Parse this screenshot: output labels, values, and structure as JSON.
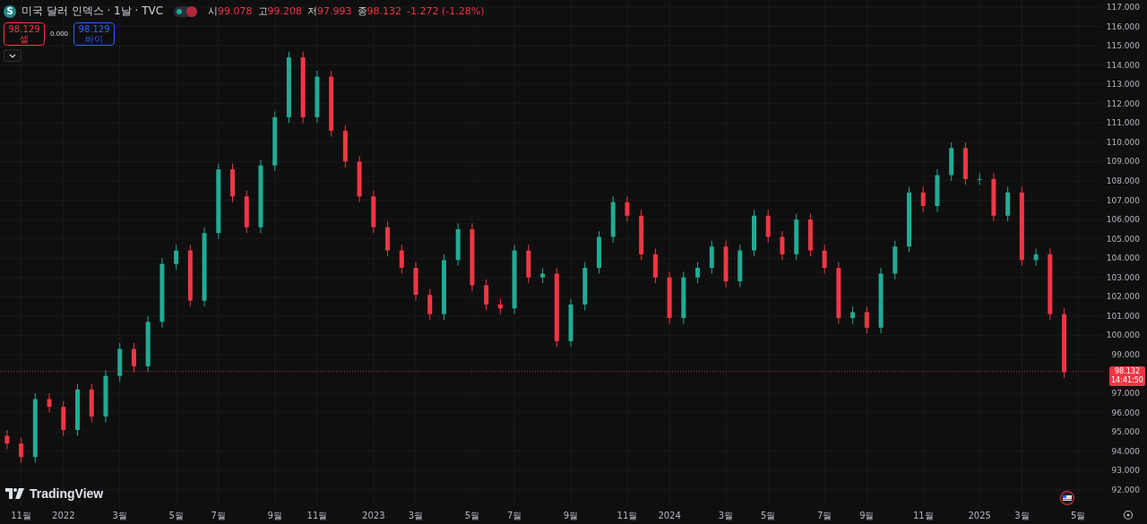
{
  "legend": {
    "symbol_letter": "S",
    "title": "미국 달러 인덱스 · 1날 · TVC",
    "ohlc": [
      {
        "label": "시",
        "value": "99.078"
      },
      {
        "label": "고",
        "value": "99.208"
      },
      {
        "label": "저",
        "value": "97.993"
      },
      {
        "label": "종",
        "value": "98.132"
      }
    ],
    "change": "-1.272 (-1.28%)"
  },
  "trade": {
    "sell_price": "98.129",
    "sell_label": "셀",
    "spread": "0.000",
    "buy_price": "98.129",
    "buy_label": "바이"
  },
  "last_price": {
    "price": "98.132",
    "countdown": "14:41:50"
  },
  "brand": "TradingView",
  "chart_data": {
    "type": "candlestick",
    "ylim": [
      91.16,
      117.37
    ],
    "grid": true,
    "ref_lines": [
      {
        "axis": "y",
        "value": 98.132,
        "color": "#f23645"
      }
    ],
    "categories": [
      null,
      "11월",
      null,
      null,
      "2022",
      null,
      null,
      null,
      "3월",
      null,
      null,
      null,
      "5월",
      null,
      null,
      "7월",
      null,
      null,
      null,
      "9월",
      null,
      null,
      "11월",
      null,
      null,
      null,
      "2023",
      null,
      null,
      "3월",
      null,
      null,
      null,
      "5월",
      null,
      null,
      "7월",
      null,
      null,
      null,
      "9월",
      null,
      null,
      null,
      "11월",
      null,
      null,
      "2024",
      null,
      null,
      null,
      "3월",
      null,
      null,
      "5월",
      null,
      null,
      null,
      "7월",
      null,
      null,
      "9월",
      null,
      null,
      null,
      "11월",
      null,
      null,
      null,
      "2025",
      null,
      null,
      "3월",
      null,
      null,
      null,
      "5월"
    ],
    "yticks": [
      {
        "value": 92,
        "label": "92.000"
      },
      {
        "value": 93,
        "label": "93.000"
      },
      {
        "value": 94,
        "label": "94.000"
      },
      {
        "value": 95,
        "label": "95.000"
      },
      {
        "value": 96,
        "label": "96.000"
      },
      {
        "value": 97,
        "label": "97.000"
      },
      {
        "value": 99,
        "label": "99.000"
      },
      {
        "value": 100,
        "label": "100.000"
      },
      {
        "value": 101,
        "label": "101.000"
      },
      {
        "value": 102,
        "label": "102.000"
      },
      {
        "value": 103,
        "label": "103.000"
      },
      {
        "value": 104,
        "label": "104.000"
      },
      {
        "value": 105,
        "label": "105.000"
      },
      {
        "value": 106,
        "label": "106.000"
      },
      {
        "value": 107,
        "label": "107.000"
      },
      {
        "value": 108,
        "label": "108.000"
      },
      {
        "value": 109,
        "label": "109.000"
      },
      {
        "value": 110,
        "label": "110.000"
      },
      {
        "value": 111,
        "label": "111.000"
      },
      {
        "value": 112,
        "label": "112.000"
      },
      {
        "value": 113,
        "label": "113.000"
      },
      {
        "value": 114,
        "label": "114.000"
      },
      {
        "value": 115,
        "label": "115.000"
      },
      {
        "value": 116,
        "label": "116.000"
      },
      {
        "value": 117,
        "label": "117.000"
      }
    ],
    "ohlc": [
      [
        94.8,
        95.1,
        94.1,
        94.4
      ],
      [
        94.4,
        94.7,
        93.4,
        93.7
      ],
      [
        93.7,
        97.0,
        93.4,
        96.7
      ],
      [
        96.7,
        97.0,
        96.0,
        96.3
      ],
      [
        96.3,
        96.6,
        94.8,
        95.1
      ],
      [
        95.1,
        97.5,
        94.8,
        97.2
      ],
      [
        97.2,
        97.5,
        95.5,
        95.8
      ],
      [
        95.8,
        98.2,
        95.5,
        97.9
      ],
      [
        97.9,
        99.6,
        97.6,
        99.3
      ],
      [
        99.3,
        99.6,
        98.1,
        98.4
      ],
      [
        98.4,
        101.0,
        98.1,
        100.7
      ],
      [
        100.7,
        104.0,
        100.4,
        103.7
      ],
      [
        103.7,
        104.7,
        103.4,
        104.4
      ],
      [
        104.4,
        104.7,
        101.5,
        101.8
      ],
      [
        101.8,
        105.6,
        101.5,
        105.3
      ],
      [
        105.3,
        108.9,
        105.0,
        108.6
      ],
      [
        108.6,
        108.9,
        106.9,
        107.2
      ],
      [
        107.2,
        107.5,
        105.3,
        105.6
      ],
      [
        105.6,
        109.1,
        105.3,
        108.8
      ],
      [
        108.8,
        111.6,
        108.5,
        111.3
      ],
      [
        111.3,
        114.7,
        111.0,
        114.4
      ],
      [
        114.4,
        114.7,
        111.0,
        111.3
      ],
      [
        111.3,
        113.7,
        111.0,
        113.4
      ],
      [
        113.4,
        113.7,
        110.3,
        110.6
      ],
      [
        110.6,
        110.9,
        108.7,
        109.0
      ],
      [
        109.0,
        109.3,
        106.9,
        107.2
      ],
      [
        107.2,
        107.5,
        105.3,
        105.6
      ],
      [
        105.6,
        105.9,
        104.1,
        104.4
      ],
      [
        104.4,
        104.7,
        103.2,
        103.5
      ],
      [
        103.5,
        103.8,
        101.8,
        102.1
      ],
      [
        102.1,
        102.4,
        100.8,
        101.1
      ],
      [
        101.1,
        104.2,
        100.8,
        103.9
      ],
      [
        103.9,
        105.8,
        103.6,
        105.5
      ],
      [
        105.5,
        105.8,
        102.3,
        102.6
      ],
      [
        102.6,
        102.9,
        101.3,
        101.6
      ],
      [
        101.6,
        101.9,
        101.1,
        101.4
      ],
      [
        101.4,
        104.7,
        101.1,
        104.4
      ],
      [
        104.4,
        104.7,
        102.7,
        103.0
      ],
      [
        103.0,
        103.5,
        102.7,
        103.2
      ],
      [
        103.2,
        103.5,
        99.4,
        99.7
      ],
      [
        99.7,
        101.9,
        99.4,
        101.6
      ],
      [
        101.6,
        103.8,
        101.3,
        103.5
      ],
      [
        103.5,
        105.4,
        103.2,
        105.1
      ],
      [
        105.1,
        107.2,
        104.8,
        106.9
      ],
      [
        106.9,
        107.2,
        105.9,
        106.2
      ],
      [
        106.2,
        106.5,
        103.9,
        104.2
      ],
      [
        104.2,
        104.5,
        102.7,
        103.0
      ],
      [
        103.0,
        103.3,
        100.6,
        100.9
      ],
      [
        100.9,
        103.3,
        100.6,
        103.0
      ],
      [
        103.0,
        103.8,
        102.7,
        103.5
      ],
      [
        103.5,
        104.9,
        103.2,
        104.6
      ],
      [
        104.6,
        104.9,
        102.5,
        102.8
      ],
      [
        102.8,
        104.7,
        102.5,
        104.4
      ],
      [
        104.4,
        106.5,
        104.1,
        106.2
      ],
      [
        106.2,
        106.5,
        104.8,
        105.1
      ],
      [
        105.1,
        105.4,
        103.9,
        104.2
      ],
      [
        104.2,
        106.3,
        103.9,
        106.0
      ],
      [
        106.0,
        106.3,
        104.1,
        104.4
      ],
      [
        104.4,
        104.7,
        103.2,
        103.5
      ],
      [
        103.5,
        103.8,
        100.6,
        100.9
      ],
      [
        100.9,
        101.5,
        100.6,
        101.2
      ],
      [
        101.2,
        101.5,
        100.1,
        100.4
      ],
      [
        100.4,
        103.5,
        100.1,
        103.2
      ],
      [
        103.2,
        104.9,
        102.9,
        104.6
      ],
      [
        104.6,
        107.7,
        104.3,
        107.4
      ],
      [
        107.4,
        107.7,
        106.4,
        106.7
      ],
      [
        106.7,
        108.6,
        106.4,
        108.3
      ],
      [
        108.3,
        110.0,
        108.0,
        109.7
      ],
      [
        109.7,
        110.0,
        107.8,
        108.1
      ],
      [
        108.1,
        108.4,
        107.8,
        108.1
      ],
      [
        108.1,
        108.4,
        105.9,
        106.2
      ],
      [
        106.2,
        107.7,
        105.9,
        107.4
      ],
      [
        107.4,
        107.7,
        103.6,
        103.9
      ],
      [
        103.9,
        104.5,
        103.6,
        104.2
      ],
      [
        104.2,
        104.5,
        100.8,
        101.1
      ],
      [
        101.1,
        101.4,
        97.8,
        98.1
      ],
      null
    ]
  }
}
